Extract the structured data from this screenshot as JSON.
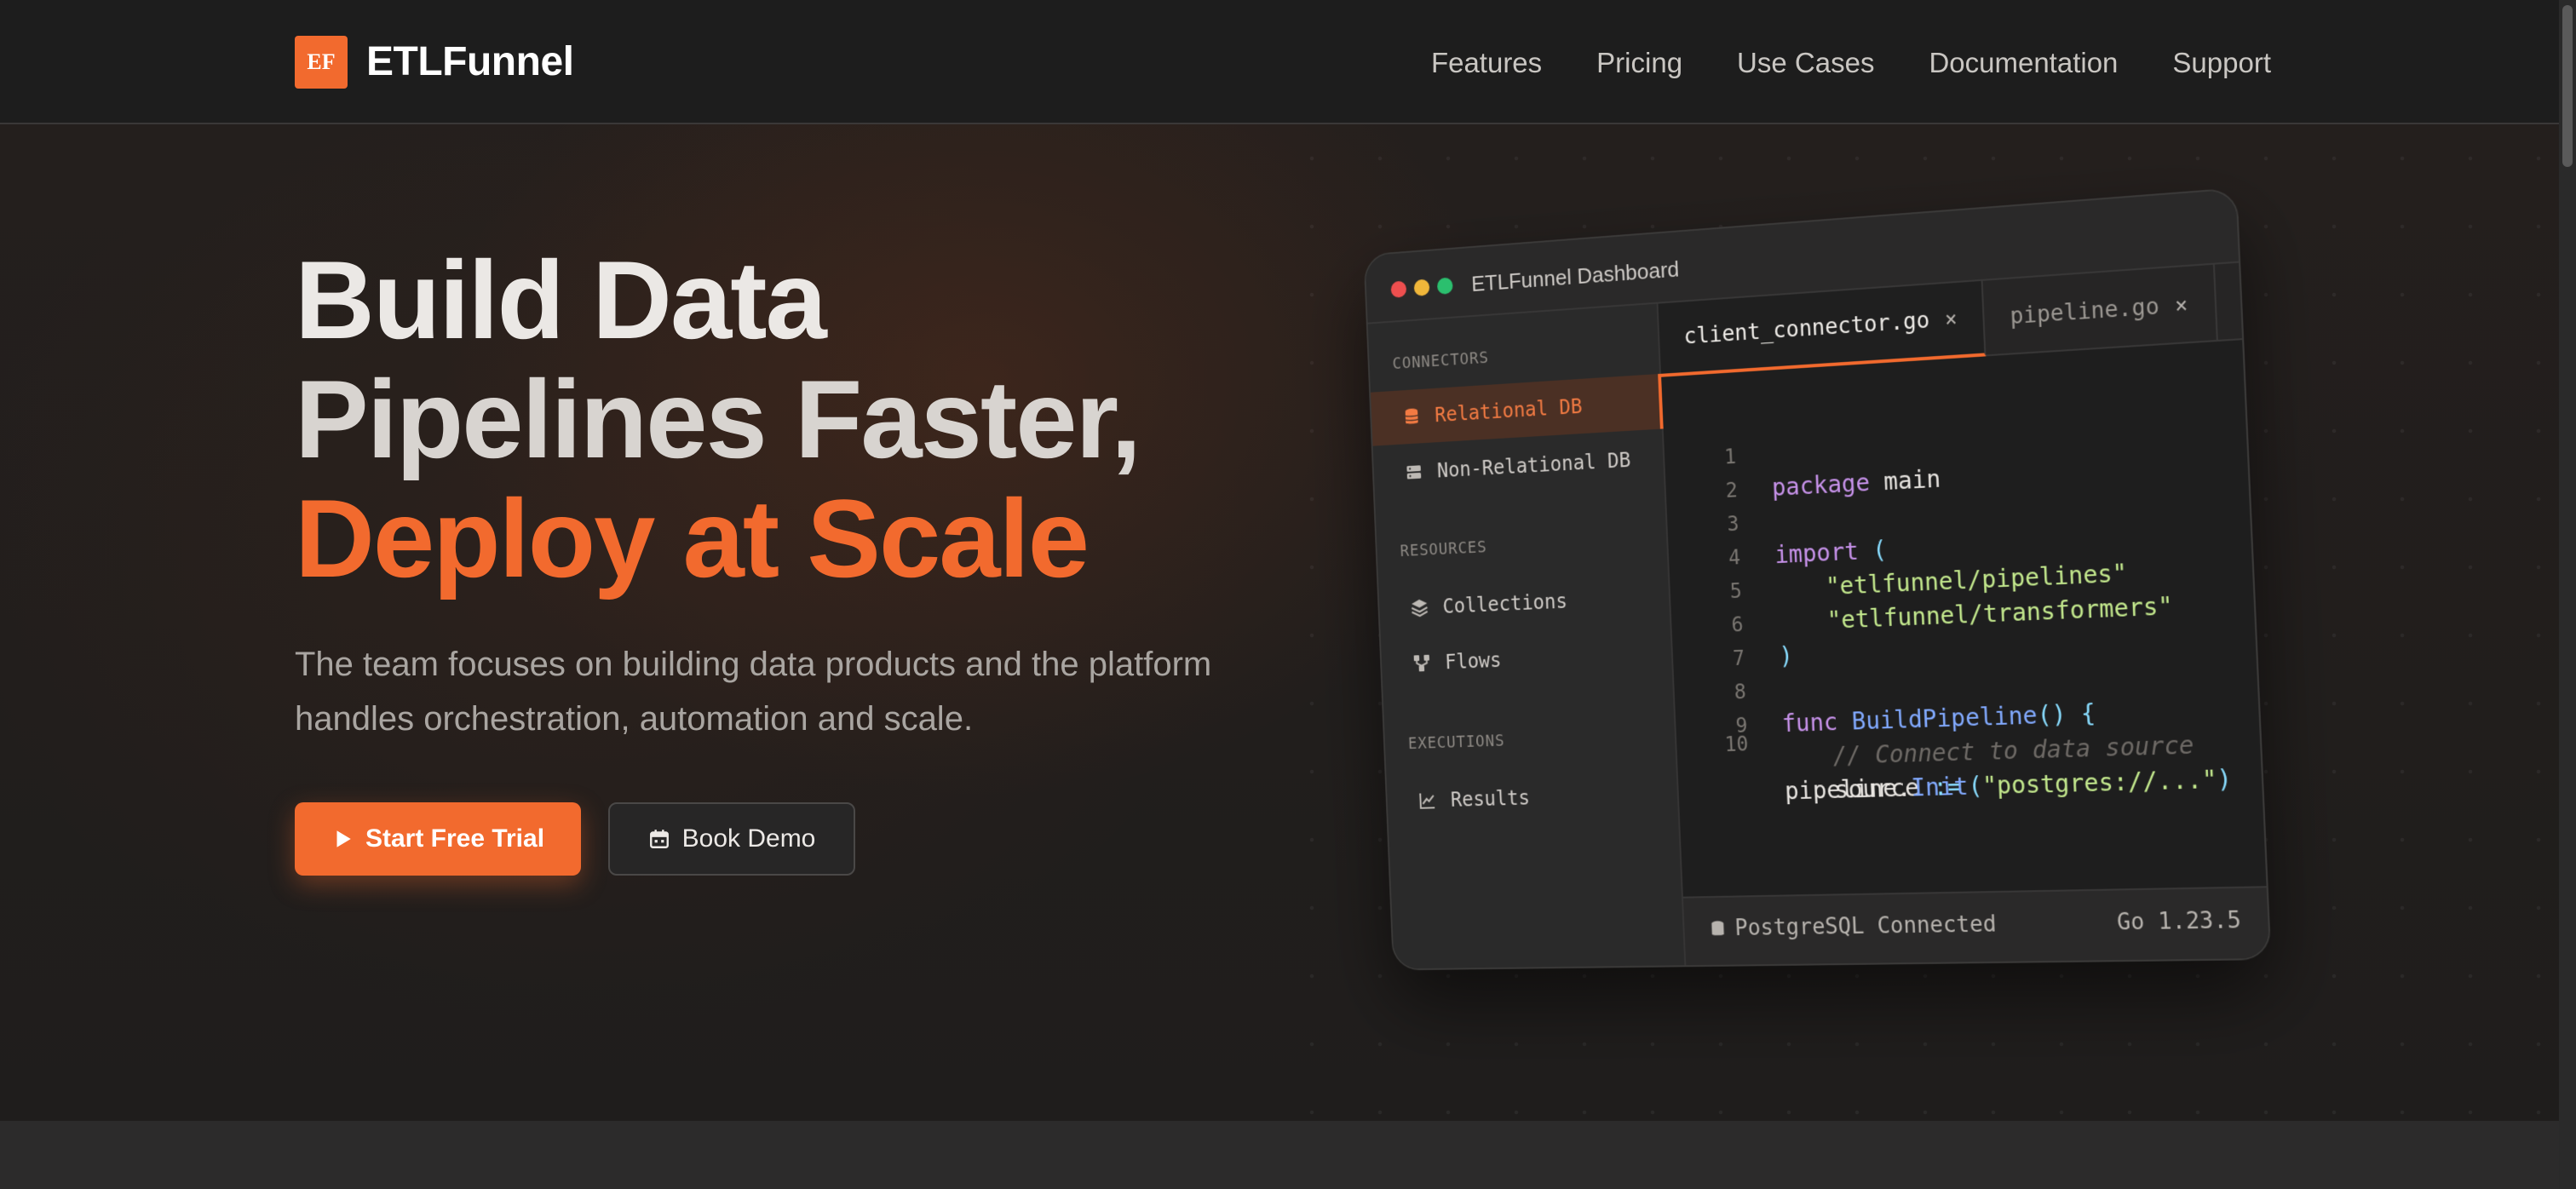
{
  "brand": {
    "badge": "EF",
    "name": "ETLFunnel",
    "accent": "#f26a2e"
  },
  "nav": {
    "items": [
      "Features",
      "Pricing",
      "Use Cases",
      "Documentation",
      "Support"
    ]
  },
  "hero": {
    "line1": "Build Data",
    "line2": "Pipelines Faster,",
    "line3": "Deploy at Scale",
    "subtitle": "The team focuses on building data products and the platform handles orchestration, automation and scale.",
    "primary_button": {
      "label": "Start Free Trial",
      "icon": "play-icon"
    },
    "secondary_button": {
      "label": "Book Demo",
      "icon": "calendar-icon"
    }
  },
  "dashboard": {
    "title": "ETLFunnel Dashboard",
    "sidebar": {
      "connectors_label": "CONNECTORS",
      "resources_label": "RESOURCES",
      "executions_label": "EXECUTIONS",
      "items": [
        {
          "label": "Relational DB",
          "icon": "database-icon",
          "active": true
        },
        {
          "label": "Non-Relational DB",
          "icon": "server-icon",
          "active": false
        },
        {
          "label": "Collections",
          "icon": "layers-icon",
          "active": false
        },
        {
          "label": "Flows",
          "icon": "flow-icon",
          "active": false
        },
        {
          "label": "Results",
          "icon": "chart-line-icon",
          "active": false
        }
      ]
    },
    "tabs": [
      {
        "label": "client_connector.go",
        "close": "×",
        "active": true
      },
      {
        "label": "pipeline.go",
        "close": "×",
        "active": false
      }
    ],
    "code": {
      "line_numbers": [
        "1",
        "2",
        "3",
        "4",
        "5",
        "6",
        "7",
        "8",
        "9",
        "10"
      ],
      "l1_kw": "package",
      "l1_rest": " main",
      "l3_kw": "import",
      "l3_rest": " (",
      "l4": "\"etlfunnel/pipelines\"",
      "l5": "\"etlfunnel/transformers\"",
      "l6": ")",
      "l8_kw": "func",
      "l8_fn": "BuildPipeline",
      "l8_rest": "() {",
      "l9": "// Connect to data source",
      "l10a_var": "source",
      "l10a_op": ":=",
      "l10b_obj": "pipeline.",
      "l10b_fn": "Init",
      "l10b_open": "(",
      "l10b_str": "\"postgres://...\"",
      "l10b_close": ")"
    },
    "status": {
      "left": "PostgreSQL Connected",
      "right": "Go 1.23.5"
    }
  }
}
